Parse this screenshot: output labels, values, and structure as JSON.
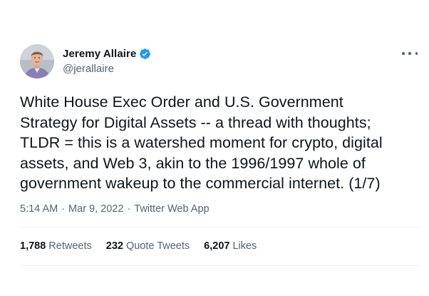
{
  "author": {
    "name": "Jeremy Allaire",
    "handle": "@jerallaire",
    "verified": true
  },
  "tweet": {
    "lines": [
      "White House Exec Order and U.S. Government",
      "Strategy for Digital Assets -- a thread with thoughts;",
      "TLDR = this is a watershed moment for crypto, digital",
      "assets, and Web 3, akin to the 1996/1997 whole of",
      "government wakeup to the commercial internet. (1/7)"
    ],
    "time": "5:14 AM",
    "separator": "·",
    "date": "Mar 9, 2022",
    "source": "Twitter Web App"
  },
  "stats": {
    "retweets_count": "1,788",
    "retweets_label": "Retweets",
    "quotes_count": "232",
    "quotes_label": "Quote Tweets",
    "likes_count": "6,207",
    "likes_label": "Likes"
  },
  "colors": {
    "verified": "#1d9bf0",
    "secondary_text": "#536471",
    "primary_text": "#0f1419"
  },
  "icons": {
    "verified": "verified-badge-icon",
    "more": "more-horizontal-icon"
  }
}
